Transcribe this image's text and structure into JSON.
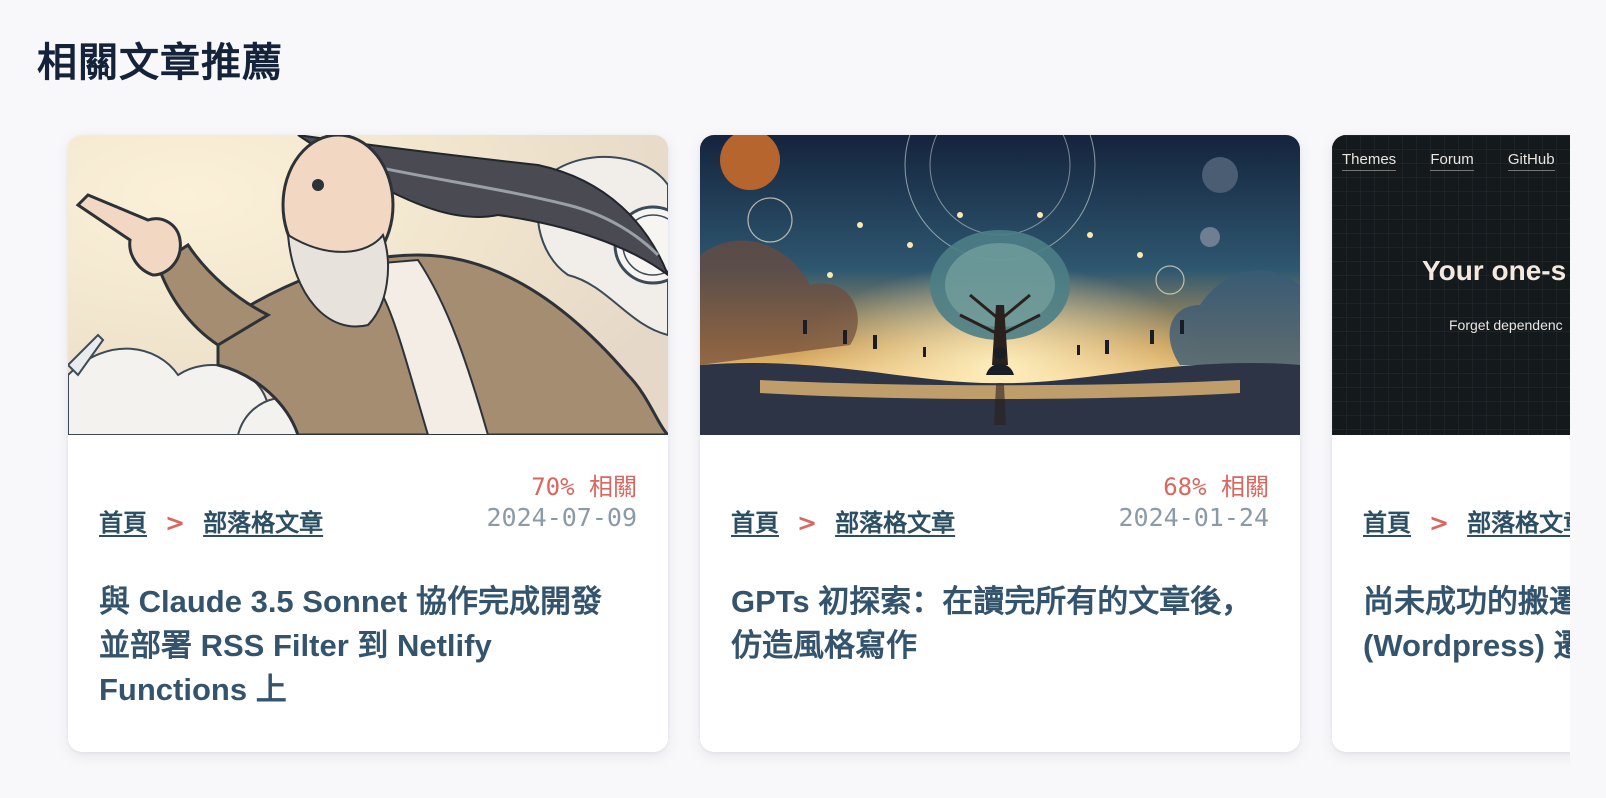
{
  "section": {
    "title": "相關文章推薦"
  },
  "cards": [
    {
      "relevance": "70% 相關",
      "date": "2024-07-09",
      "breadcrumb": {
        "home": "首頁",
        "separator": ">",
        "category": "部落格文章"
      },
      "title": "與 Claude 3.5 Sonnet 協作完成開發並部署 RSS Filter 到 Netlify Functions 上",
      "image_icon": "cartoon-man-pointing-illustration"
    },
    {
      "relevance": "68% 相關",
      "date": "2024-01-24",
      "breadcrumb": {
        "home": "首頁",
        "separator": ">",
        "category": "部落格文章"
      },
      "title": "GPTs 初探索：在讀完所有的文章後，仿造風格寫作",
      "image_icon": "cosmic-tree-meditation-illustration"
    },
    {
      "relevance": "",
      "date": "",
      "breadcrumb": {
        "home": "首頁",
        "separator": ">",
        "category": "部落格文章"
      },
      "title_line1": "尚未成功的搬遷",
      "title_line2": "(Wordpress) 遷",
      "image_icon": "theme-website-screenshot",
      "screenshot_text": {
        "nav": [
          "Themes",
          "Forum",
          "GitHub"
        ],
        "hero": "Your one-s",
        "sub": "Forget dependenc"
      }
    }
  ],
  "colors": {
    "title": "#14233a",
    "link": "#2c4f63",
    "accent": "#d9665f",
    "muted": "#8a9aa7",
    "card_title": "#34546e"
  }
}
